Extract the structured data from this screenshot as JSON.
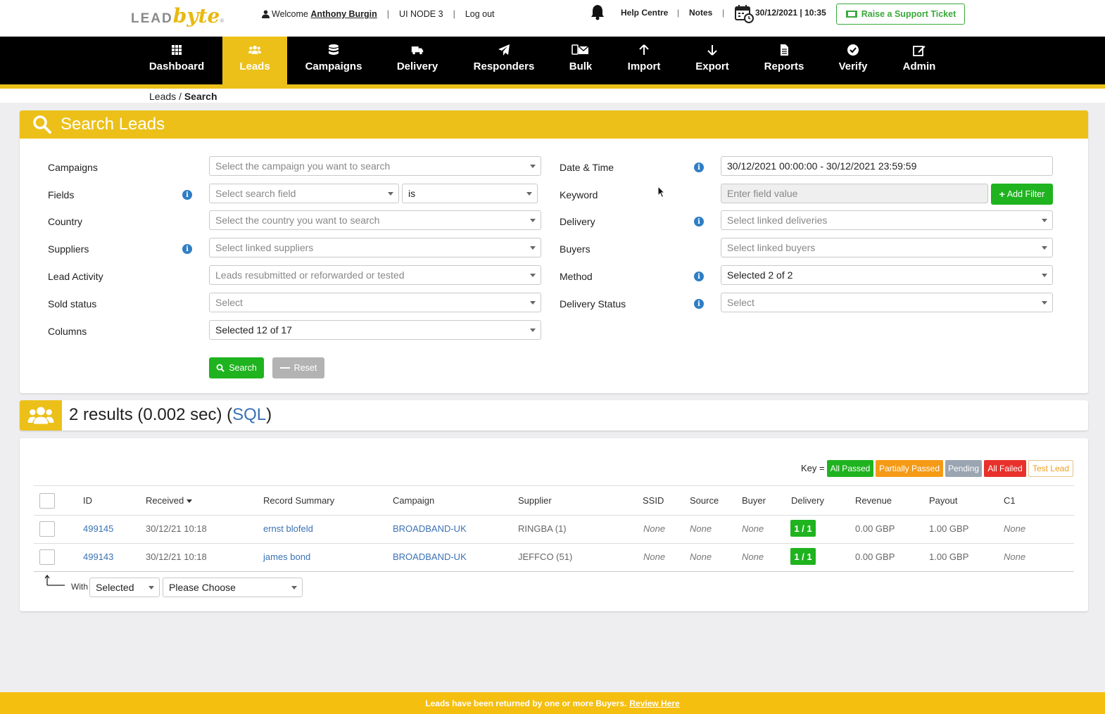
{
  "header": {
    "logo_lead": "LEAD",
    "logo_byte": "byte",
    "welcome_prefix": "Welcome",
    "user_name": "Anthony Burgin",
    "node": "UI NODE 3",
    "logout": "Log out",
    "help_centre": "Help Centre",
    "notes": "Notes",
    "datetime": "30/12/2021 | 10:35",
    "ticket": "Raise a Support Ticket"
  },
  "nav": {
    "dashboard": "Dashboard",
    "leads": "Leads",
    "campaigns": "Campaigns",
    "delivery": "Delivery",
    "responders": "Responders",
    "bulk": "Bulk",
    "import": "Import",
    "export": "Export",
    "reports": "Reports",
    "verify": "Verify",
    "admin": "Admin"
  },
  "breadcrumb": {
    "parent": "Leads",
    "sep": " / ",
    "current": "Search"
  },
  "search_panel": {
    "title": "Search Leads",
    "labels": {
      "campaigns": "Campaigns",
      "fields": "Fields",
      "country": "Country",
      "suppliers": "Suppliers",
      "lead_activity": "Lead Activity",
      "sold_status": "Sold status",
      "columns": "Columns",
      "date_time": "Date & Time",
      "keyword": "Keyword",
      "delivery": "Delivery",
      "buyers": "Buyers",
      "method": "Method",
      "delivery_status": "Delivery Status"
    },
    "values": {
      "campaigns": "Select the campaign you want to search",
      "fields": "Select search field",
      "operator": "is",
      "country": "Select the country you want to search",
      "suppliers": "Select linked suppliers",
      "lead_activity": "Leads resubmitted or reforwarded or tested",
      "sold_status": "Select",
      "columns": "Selected 12 of 17",
      "date_time": "30/12/2021 00:00:00 - 30/12/2021 23:59:59",
      "keyword_placeholder": "Enter field value",
      "delivery": "Select linked deliveries",
      "buyers": "Select linked buyers",
      "method": "Selected 2 of 2",
      "delivery_status": "Select"
    },
    "add_filter": "Add Filter",
    "search_btn": "Search",
    "reset_btn": "Reset"
  },
  "results": {
    "count_text": "2 results (0.002 sec) (",
    "sql": "SQL",
    "close": ")"
  },
  "key": {
    "label": "Key =",
    "all_passed": "All Passed",
    "partially_passed": "Partially Passed",
    "pending": "Pending",
    "all_failed": "All Failed",
    "test_lead": "Test Lead",
    "colors": {
      "all_passed": "#1fb31f",
      "partially_passed": "#f59a16",
      "pending": "#9aa5b1",
      "all_failed": "#e8312b",
      "test_lead": "#f0a020"
    }
  },
  "table": {
    "headers": {
      "id": "ID",
      "received": "Received",
      "summary": "Record Summary",
      "campaign": "Campaign",
      "supplier": "Supplier",
      "ssid": "SSID",
      "source": "Source",
      "buyer": "Buyer",
      "delivery": "Delivery",
      "revenue": "Revenue",
      "payout": "Payout",
      "c1": "C1"
    },
    "rows": [
      {
        "id": "499145",
        "received": "30/12/21 10:18",
        "summary": "ernst blofeld",
        "campaign": "BROADBAND-UK",
        "supplier": "RINGBA (1)",
        "ssid": "None",
        "source": "None",
        "buyer": "None",
        "delivery": "1 / 1",
        "revenue": "0.00 GBP",
        "payout": "1.00 GBP",
        "c1": "None"
      },
      {
        "id": "499143",
        "received": "30/12/21 10:18",
        "summary": "james bond",
        "campaign": "BROADBAND-UK",
        "supplier": "JEFFCO (51)",
        "ssid": "None",
        "source": "None",
        "buyer": "None",
        "delivery": "1 / 1",
        "revenue": "0.00 GBP",
        "payout": "1.00 GBP",
        "c1": "None"
      }
    ]
  },
  "bulk": {
    "with_label": "With",
    "selected": "Selected",
    "action": "Please Choose"
  },
  "footer": {
    "message": "Leads have been returned by one or more Buyers.",
    "link": "Review Here"
  },
  "colors": {
    "accent": "#ecc019",
    "nav_bg": "#000000",
    "green": "#1fb31f",
    "link": "#3a72b5"
  }
}
